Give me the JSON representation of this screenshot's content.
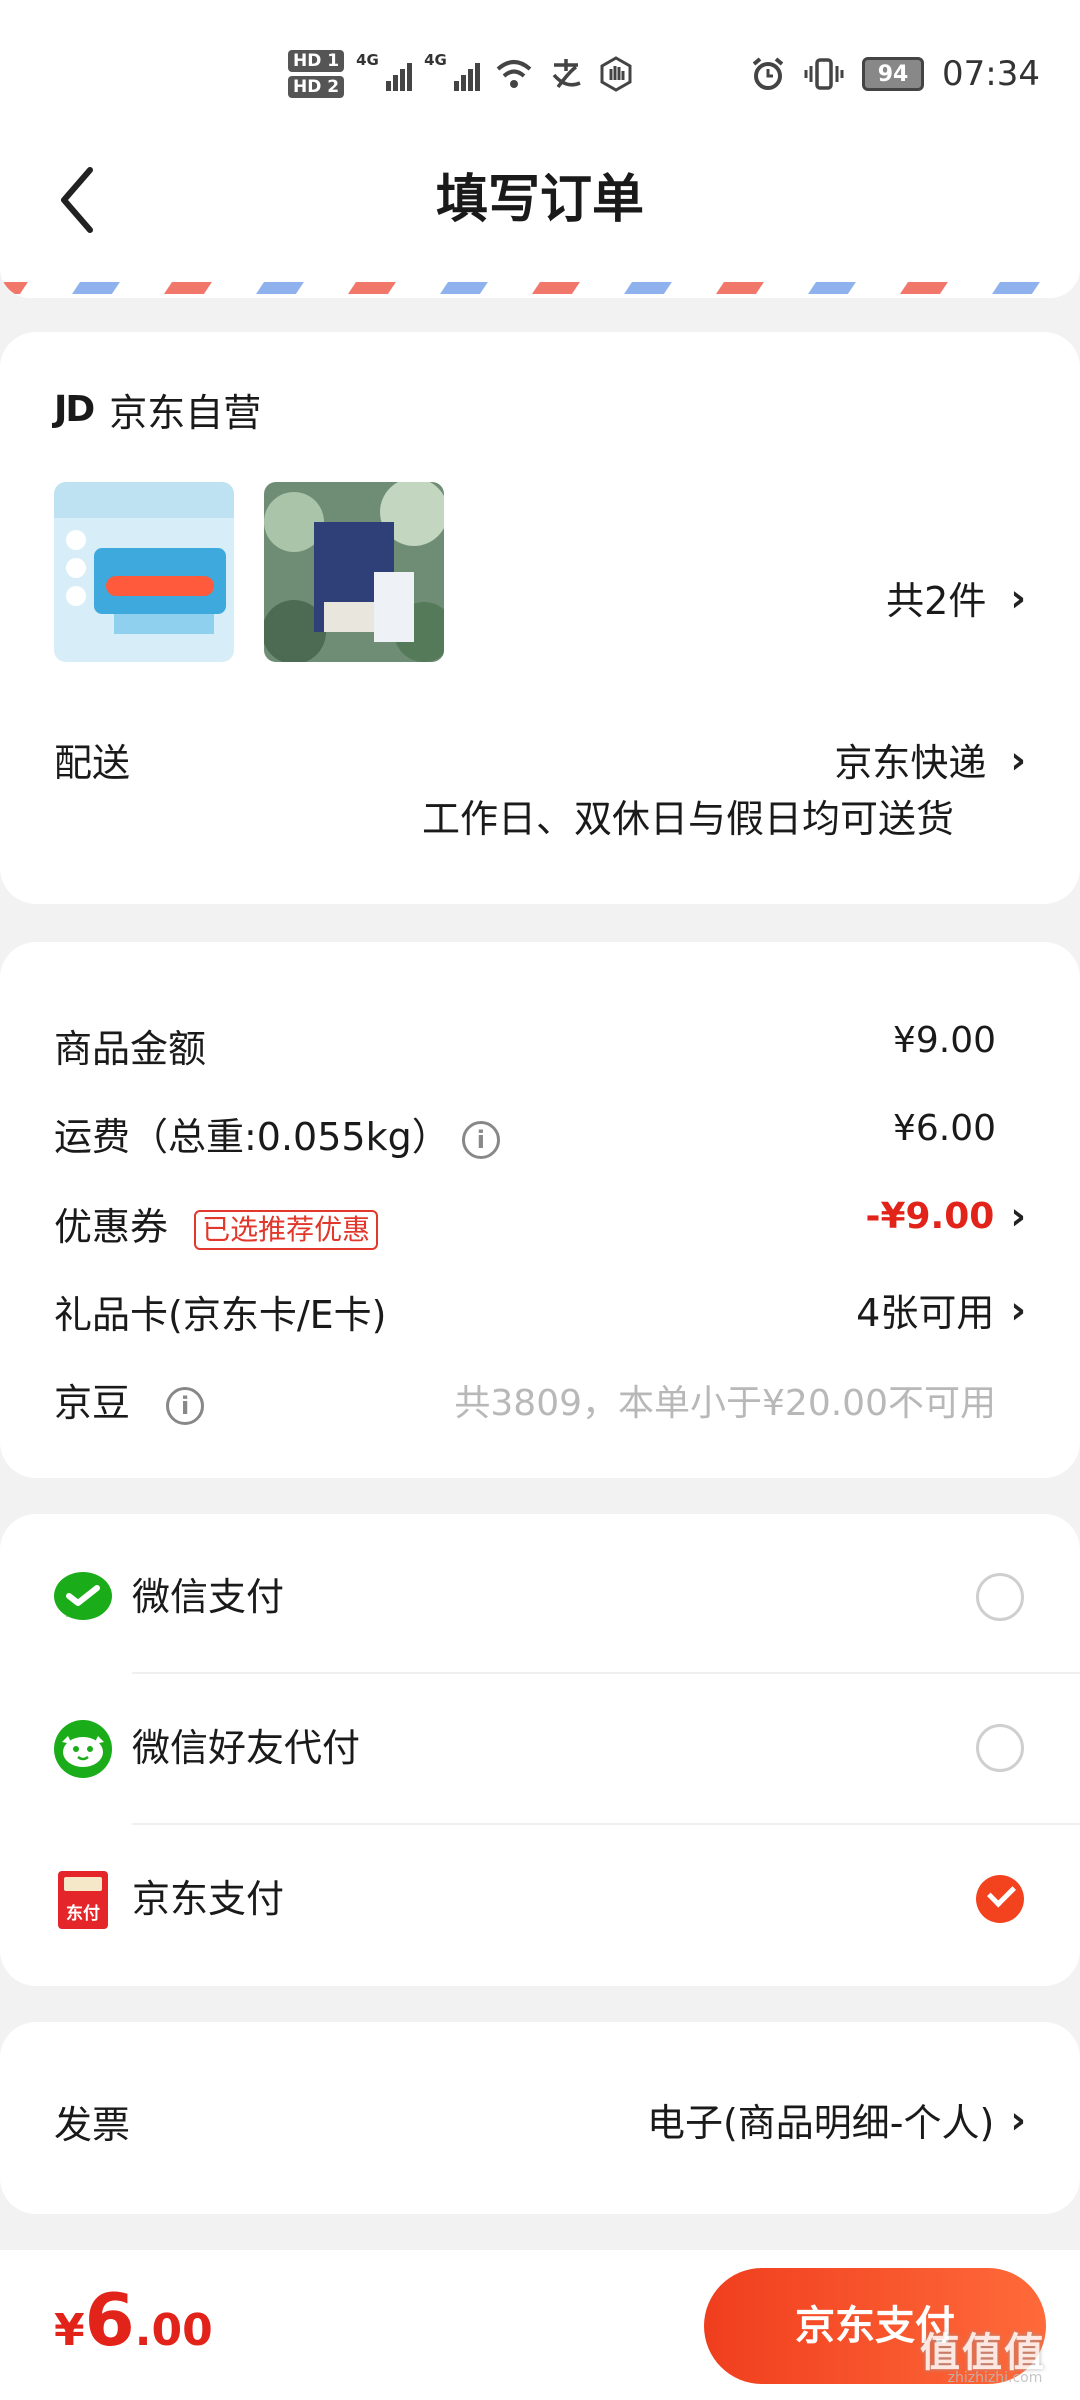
{
  "status_bar": {
    "hd1": "HD 1",
    "hd2": "HD 2",
    "net1": "4G",
    "net2": "4G",
    "battery": "94",
    "time": "07:34"
  },
  "header": {
    "title": "填写订单"
  },
  "store": {
    "name": "京东自营",
    "logo_text": "JD",
    "item_count": "共2件"
  },
  "delivery": {
    "label": "配送",
    "method": "京东快递",
    "note": "工作日、双休日与假日均可送货"
  },
  "amounts": {
    "goods_label": "商品金额",
    "goods_value": "¥9.00",
    "shipping_label": "运费（总重:0.055kg）",
    "shipping_value": "¥6.00",
    "coupon_label": "优惠券",
    "coupon_badge": "已选推荐优惠",
    "coupon_value": "-¥9.00",
    "giftcard_label": "礼品卡(京东卡/E卡)",
    "giftcard_value": "4张可用",
    "beans_label": "京豆",
    "beans_value": "共3809，本单小于¥20.00不可用"
  },
  "payment": {
    "options": [
      {
        "label": "微信支付",
        "selected": false
      },
      {
        "label": "微信好友代付",
        "selected": false
      },
      {
        "label": "京东支付",
        "selected": true
      }
    ],
    "jd_icon_text": "东付"
  },
  "invoice": {
    "label": "发票",
    "value": "电子(商品明细-个人)"
  },
  "footer": {
    "currency": "¥",
    "total_int": "6",
    "total_dec": ".00",
    "pay_button": "京东支付"
  },
  "watermark": {
    "text": "值值值",
    "sub": "zhizhizhi.com"
  },
  "colors": {
    "accent": "#e2231a",
    "button_start": "#f03e1e",
    "button_end": "#ff6a3a",
    "wechat_green": "#1aad19"
  }
}
